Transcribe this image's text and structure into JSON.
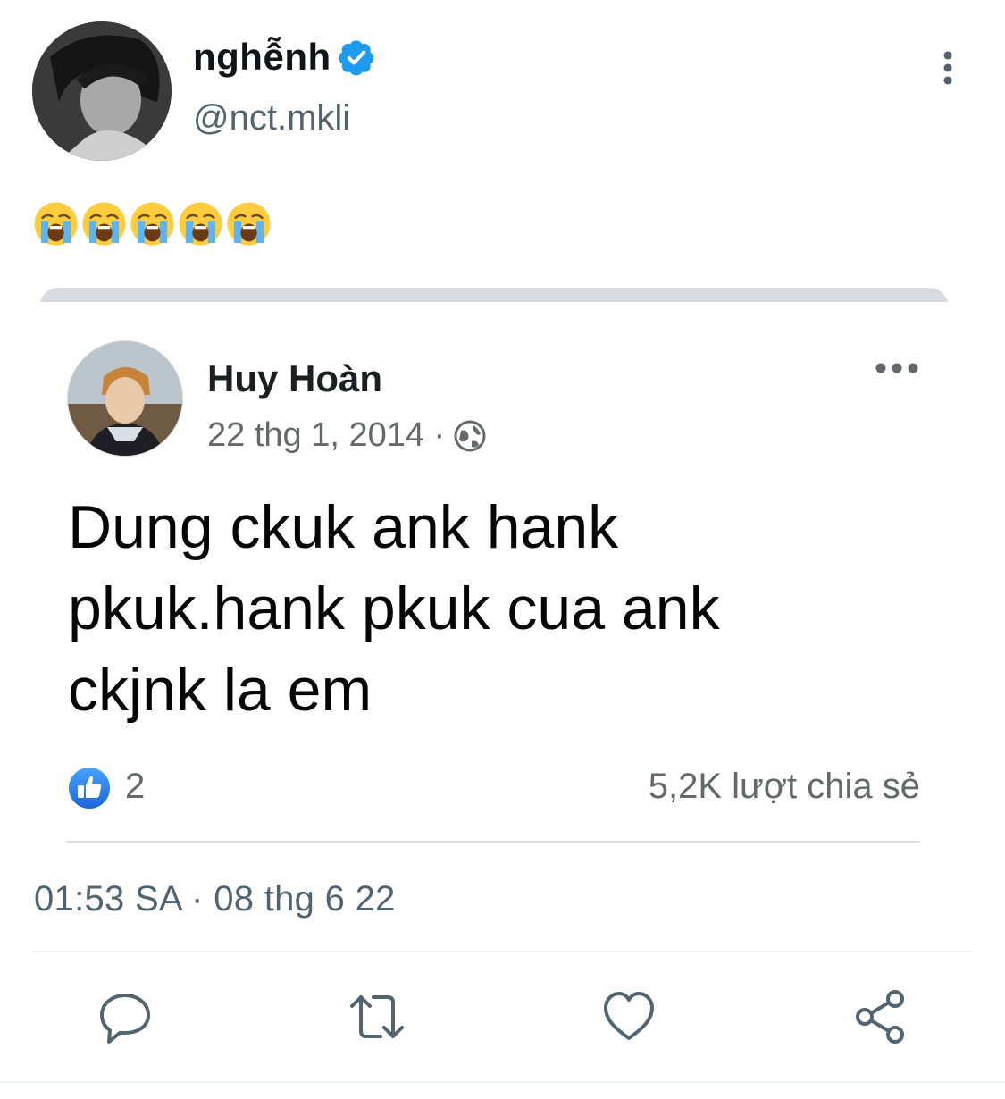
{
  "tweet": {
    "author": {
      "display_name": "nghễnh",
      "handle": "@nct.mkli",
      "verified": true
    },
    "text": "😭😭😭😭😭",
    "emoji_icon": "loudly-crying-face",
    "timestamp": "01:53 SA · 08 thg 6 22",
    "actions": [
      "reply",
      "retweet",
      "like",
      "share"
    ]
  },
  "embedded_post": {
    "author": "Huy Hoàn",
    "date": "22 thg 1, 2014 ·",
    "privacy_icon": "globe-icon",
    "text_lines": [
      "Dung ckuk ank hank",
      "pkuk.hank pkuk cua ank",
      "ckjnk la em"
    ],
    "like_count": "2",
    "shares": "5,2K lượt chia sẻ"
  },
  "colors": {
    "verified_blue": "#1d9bf0",
    "secondary_text": "#536471",
    "fb_like_blue": "#1877f2"
  }
}
